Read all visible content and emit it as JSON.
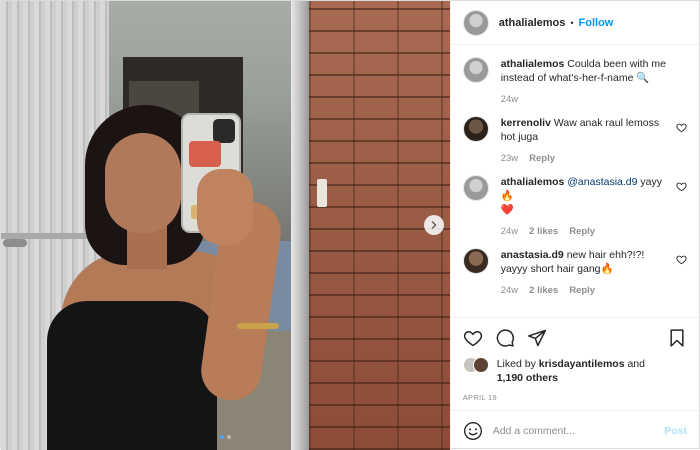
{
  "header": {
    "username": "athalialemos",
    "separator": "•",
    "follow_label": "Follow"
  },
  "caption": {
    "username": "athalialemos",
    "text": "Coulda been with me instead of what's-her-f-name",
    "emoji": "🔍",
    "age": "24w"
  },
  "comments": [
    {
      "username": "kerrenoliv",
      "text": "Waw anak raul lemoss hot juga",
      "age": "23w",
      "likes": "",
      "reply_label": "Reply"
    },
    {
      "username": "athalialemos",
      "mention": "@anastasia.d9",
      "text": "yayy",
      "emoji": "🔥",
      "emoji2": "❤️",
      "age": "24w",
      "likes": "2 likes",
      "reply_label": "Reply"
    },
    {
      "username": "anastasia.d9",
      "text": "new hair ehh?!?! yayyy short hair gang",
      "emoji": "🔥",
      "age": "24w",
      "likes": "2 likes",
      "reply_label": "Reply"
    }
  ],
  "likes": {
    "prefix": "Liked by",
    "user": "krisdayantilemos",
    "joiner": "and",
    "others": "1,190 others"
  },
  "date": "APRIL 19",
  "add_comment": {
    "placeholder": "Add a comment...",
    "post_label": "Post"
  },
  "carousel": {
    "slide_count": 2,
    "active_index": 0
  },
  "icons": {
    "header_avatar": "avatar",
    "next": "chevron-right-icon",
    "like": "heart-icon",
    "comment": "comment-icon",
    "share": "share-icon",
    "save": "bookmark-icon",
    "emoji": "smiley-icon"
  },
  "colors": {
    "accent": "#0095f6",
    "mention": "#00376b",
    "muted": "#8e8e8e",
    "post_disabled": "#b2dffc",
    "carousel_active": "#4ea2f0"
  }
}
